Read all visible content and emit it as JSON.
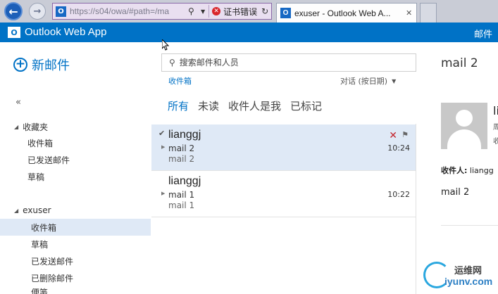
{
  "browser": {
    "url": "https://s04/owa/#path=/ma",
    "cert_error": "证书错误",
    "tab_title": "exuser - Outlook Web A...",
    "favicon_letter": "O",
    "back_glyph": "←",
    "forward_glyph": "→"
  },
  "owa": {
    "app_name": "Outlook Web App",
    "header_mail_label": "邮件",
    "brand_color": "#0072c6"
  },
  "nav": {
    "new_mail": "新邮件",
    "collapse": "«",
    "favorites_header": "收藏夹",
    "favorites": [
      "收件箱",
      "已发送邮件",
      "草稿"
    ],
    "account_header": "exuser",
    "folders": [
      "收件箱",
      "草稿",
      "已发送邮件",
      "已删除邮件",
      "便笺"
    ]
  },
  "list": {
    "search_placeholder": "搜索邮件和人员",
    "folder_label": "收件箱",
    "sort_label": "对话 (按日期)",
    "filters": [
      "所有",
      "未读",
      "收件人是我",
      "已标记"
    ],
    "items": [
      {
        "sender": "lianggj",
        "subject": "mail 2",
        "preview": "mail 2",
        "time": "10:24"
      },
      {
        "sender": "lianggj",
        "subject": "mail 1",
        "preview": "mail 1",
        "time": "10:22"
      }
    ]
  },
  "reading": {
    "subject": "mail 2",
    "sender": "li",
    "meta1": "周",
    "meta2": "收",
    "to_label": "收件人:",
    "to_value": "liangg",
    "body": "mail 2"
  },
  "watermark": {
    "line1": "运维网",
    "line2": "iyunv.com"
  }
}
